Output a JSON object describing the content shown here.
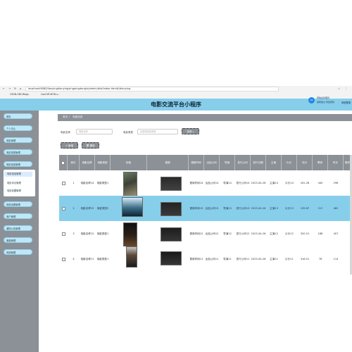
{
  "browser": {
    "url": "localhost:8080/lianyingdianyingyingpingdenglu/admin/dist/index.html#/dianying",
    "bookmarks": [
      "CSDN-GBC-Blogs",
      "Conf-VR-MOD-s..."
    ],
    "profile_badge": "登陆后管理员",
    "profile_sub": "编辑信息 修改密码"
  },
  "app": {
    "title": "电影交流平台小程序",
    "user_right": "系统登录"
  },
  "sidebar": {
    "items": [
      "首页",
      "个人中心",
      "电影管理",
      "电影类型管理",
      "电影信息管理",
      "电影评论管理",
      "电影收藏管理",
      "系统设置管理",
      "用户管理",
      "通知公告管理",
      "客服管理",
      "系统管理"
    ],
    "sub_items": [
      "电影评论管理",
      "电影收藏管理"
    ],
    "active": "电影信息管理"
  },
  "breadcrumb": {
    "home": "首页",
    "sep": "/",
    "current": "电影信息"
  },
  "filters": {
    "name_label": "电影名称",
    "name_placeholder": "电影名称",
    "type_label": "电影类型",
    "type_placeholder": "请选择电影类型",
    "search_button": "查询"
  },
  "actions": {
    "add": "新增",
    "delete": "删除"
  },
  "table": {
    "headers": [
      "",
      "索引",
      "电影名称",
      "电影类型",
      "封面",
      "视频",
      "更新时间",
      "出品公司",
      "导演",
      "发行公司",
      "发行日期",
      "主演",
      "片长",
      "评分",
      "票房",
      "时长",
      "操作"
    ],
    "rows": [
      {
        "index": "1",
        "name": "电影名称14",
        "type": "电影类型1",
        "update": "更新时间14",
        "company": "出品公司14",
        "director": "导演14",
        "publisher": "发行公司14",
        "date": "2023-04-26",
        "actor": "主演14",
        "length": "片长14",
        "score": "161.28",
        "box": "440",
        "time": "298"
      },
      {
        "index": "2",
        "name": "电影名称15",
        "type": "电影类型2",
        "update": "更新时间13",
        "company": "出品公司13",
        "director": "导演13",
        "publisher": "发行公司13",
        "date": "2023-04-26",
        "actor": "主演13",
        "length": "片长13",
        "score": "195.87",
        "box": "217",
        "time": "482"
      },
      {
        "index": "3",
        "name": "电影名称12",
        "type": "电影类型1",
        "update": "更新时间12",
        "company": "出品公司12",
        "director": "导演12",
        "publisher": "发行公司12",
        "date": "2023-04-26",
        "actor": "主演12",
        "length": "片长12",
        "score": "320.51",
        "box": "188",
        "time": "407"
      },
      {
        "index": "4",
        "name": "电影名称11",
        "type": "电影类型1",
        "update": "更新时间11",
        "company": "出品公司11",
        "director": "导演11",
        "publisher": "发行公司11",
        "date": "2023-04-26",
        "actor": "主演11",
        "length": "片长11",
        "score": "316.51",
        "box": "78",
        "time": "114"
      }
    ]
  }
}
